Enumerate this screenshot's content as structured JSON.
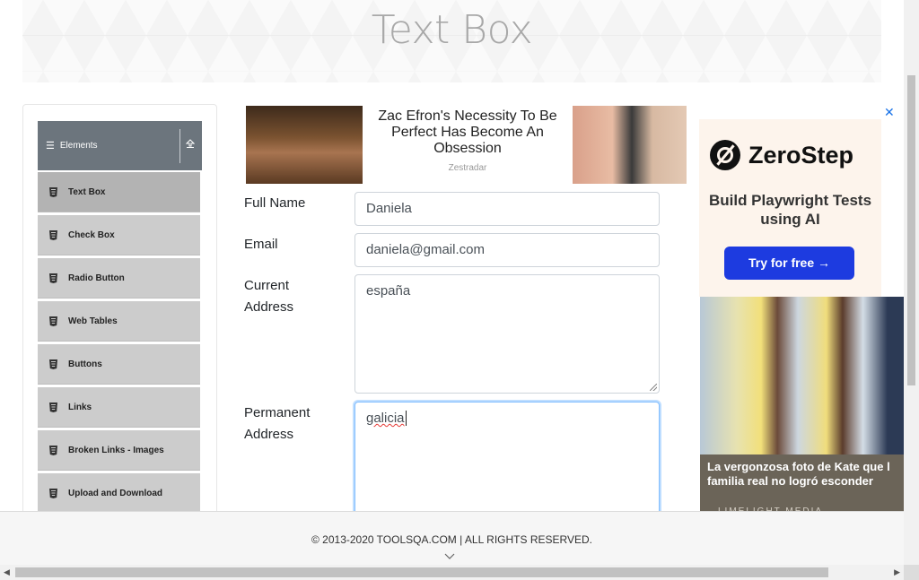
{
  "page": {
    "title": "Text Box"
  },
  "sidebar": {
    "group_title": "Elements",
    "group_icon": "hamburger-icon",
    "collapse_icon": "upload-arrow-icon",
    "items": [
      {
        "label": "Text Box",
        "active": true
      },
      {
        "label": "Check Box"
      },
      {
        "label": "Radio Button"
      },
      {
        "label": "Web Tables"
      },
      {
        "label": "Buttons"
      },
      {
        "label": "Links"
      },
      {
        "label": "Broken Links - Images"
      },
      {
        "label": "Upload and Download"
      }
    ]
  },
  "ad_top": {
    "headline": "Zac Efron's Necessity To Be Perfect Has Become An Obsession",
    "source": "Zestradar"
  },
  "form": {
    "full_name_label": "Full Name",
    "full_name_value": "Daniela",
    "email_label": "Email",
    "email_value": "daniela@gmail.com",
    "current_address_label_line1": "Current",
    "current_address_label_line2": "Address",
    "current_address_value": "españa",
    "permanent_address_label_line1": "Permanent",
    "permanent_address_label_line2": "Address",
    "permanent_address_value": "galicia"
  },
  "ad_right": {
    "brand": "ZeroStep",
    "tagline": "Build Playwright Tests using AI",
    "cta": "Try for free →",
    "caption": "La vergonzosa foto de Kate que la familia real no logró esconder",
    "caption_line1": "La vergonzosa foto de Kate que l",
    "caption_line2": "familia real no logró esconder",
    "source": "LIMELIGHT MEDIA",
    "close_icon": "close-icon",
    "accent": "#1d3be0"
  },
  "footer": {
    "copyright": "© 2013-2020 TOOLSQA.COM | ALL RIGHTS RESERVED."
  }
}
